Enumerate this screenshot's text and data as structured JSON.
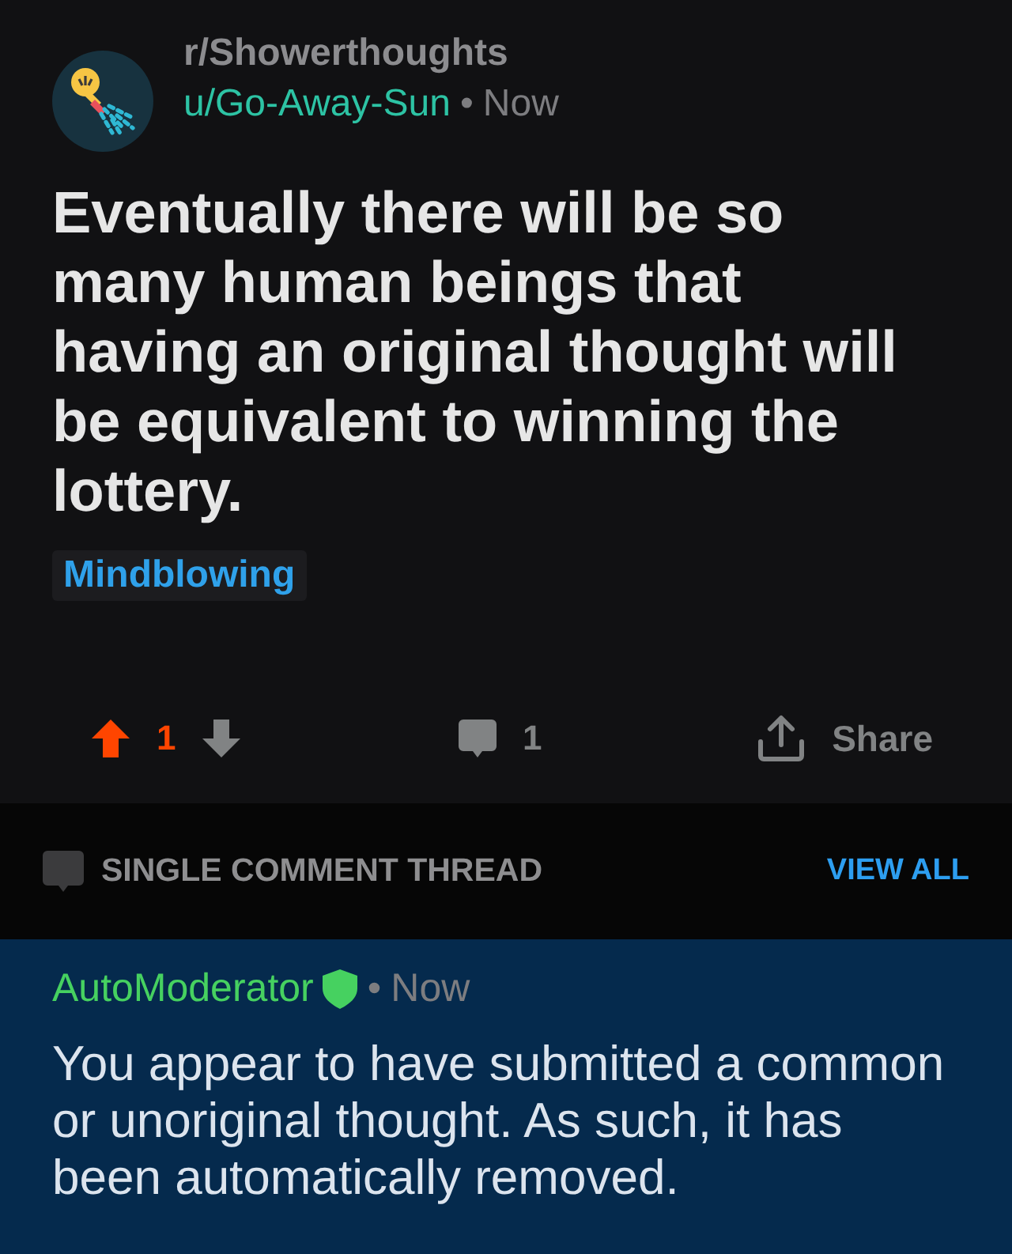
{
  "post": {
    "subreddit": "r/Showerthoughts",
    "author": "u/Go-Away-Sun",
    "separator": "•",
    "time": "Now",
    "title": "Eventually there will be so many human beings that having an original thought will be equivalent to winning the lottery.",
    "flair": "Mindblowing"
  },
  "actions": {
    "upvoted": true,
    "score": "1",
    "downvoted": false,
    "comments": "1",
    "share": "Share"
  },
  "thread_bar": {
    "label": "SINGLE COMMENT THREAD",
    "link": "VIEW ALL"
  },
  "comment": {
    "author": "AutoModerator",
    "moderator": true,
    "separator": "•",
    "time": "Now",
    "body": "You appear to have submitted a common or unoriginal thought. As such, it has been automatically removed."
  }
}
